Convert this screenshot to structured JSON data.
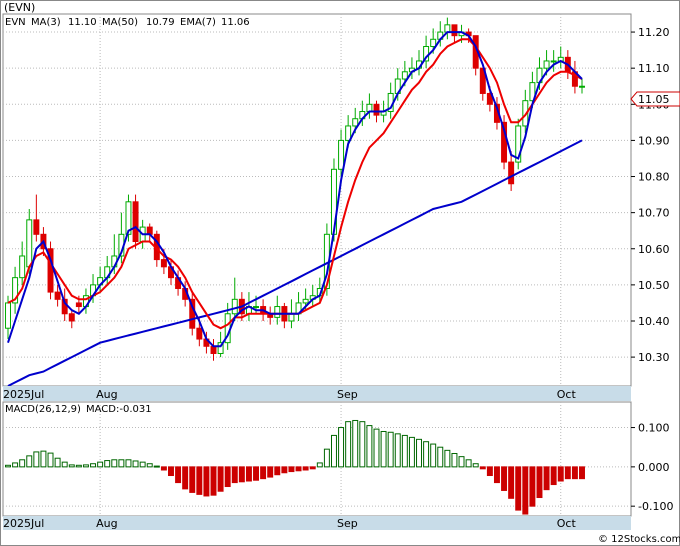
{
  "ticker_label": "(EVN)",
  "legend": {
    "symbol": "EVN",
    "ma3_label": "MA(3)",
    "ma3_value": "11.10",
    "ma50_label": "MA(50)",
    "ma50_value": "10.79",
    "ema7_label": "EMA(7)",
    "ema7_value": "11.06"
  },
  "macd_legend": {
    "label": "MACD(26,12,9)",
    "value_label": "MACD:-0.031"
  },
  "price_tag": "11.05",
  "watermark": "© 12Stocks.com",
  "price_axis": {
    "ticks": [
      "11.20",
      "11.10",
      "11.00",
      "10.90",
      "10.80",
      "10.70",
      "10.60",
      "10.50",
      "10.40",
      "10.30"
    ],
    "tick_values": [
      11.2,
      11.1,
      11.0,
      10.9,
      10.8,
      10.7,
      10.6,
      10.5,
      10.4,
      10.3
    ],
    "range": [
      10.22,
      11.25
    ]
  },
  "macd_axis": {
    "ticks": [
      "0.100",
      "0.000",
      "-0.100"
    ],
    "tick_values": [
      0.1,
      0.0,
      -0.1
    ],
    "range": [
      -0.125,
      0.165
    ]
  },
  "time_axis": {
    "labels": [
      "2025Jul",
      "Aug",
      "Sep",
      "Oct"
    ],
    "label_index": [
      0,
      13,
      47,
      78
    ]
  },
  "colors": {
    "up": "#00aa00",
    "down": "#dd0000",
    "ma": "#0000cc",
    "ema": "#ee0000",
    "macd_up": "#006600",
    "macd_down": "#cc0000",
    "axis_band": "#c8dce8",
    "grid": "#bbbbbb"
  },
  "chart_data": {
    "type": "candlestick",
    "count": 95,
    "candles": {
      "open": [
        10.38,
        10.45,
        10.52,
        10.55,
        10.68,
        10.64,
        10.6,
        10.48,
        10.46,
        10.42,
        10.45,
        10.44,
        10.47,
        10.5,
        10.52,
        10.55,
        10.58,
        10.64,
        10.73,
        10.62,
        10.66,
        10.64,
        10.57,
        10.55,
        10.52,
        10.49,
        10.46,
        10.38,
        10.35,
        10.33,
        10.31,
        10.34,
        10.42,
        10.46,
        10.42,
        10.44,
        10.44,
        10.42,
        10.41,
        10.44,
        10.4,
        10.42,
        10.45,
        10.46,
        10.47,
        10.49,
        10.64,
        10.82,
        10.9,
        10.94,
        10.96,
        10.98,
        11.0,
        10.97,
        10.98,
        11.03,
        11.07,
        11.09,
        11.1,
        11.12,
        11.16,
        11.18,
        11.2,
        11.22,
        11.19,
        11.2,
        11.19,
        11.1,
        11.03,
        11.0,
        10.95,
        10.84,
        10.84,
        10.94,
        11.01,
        11.06,
        11.1,
        11.12,
        11.12,
        11.13,
        11.09,
        11.05
      ],
      "close": [
        10.45,
        10.52,
        10.58,
        10.68,
        10.64,
        10.6,
        10.48,
        10.46,
        10.42,
        10.4,
        10.44,
        10.47,
        10.5,
        10.52,
        10.55,
        10.58,
        10.64,
        10.73,
        10.62,
        10.66,
        10.64,
        10.57,
        10.55,
        10.52,
        10.49,
        10.46,
        10.38,
        10.35,
        10.33,
        10.31,
        10.34,
        10.42,
        10.46,
        10.42,
        10.44,
        10.44,
        10.42,
        10.41,
        10.44,
        10.4,
        10.42,
        10.45,
        10.46,
        10.47,
        10.49,
        10.64,
        10.82,
        10.9,
        10.94,
        10.96,
        10.98,
        11.0,
        10.97,
        10.98,
        11.03,
        11.07,
        11.09,
        11.1,
        11.12,
        11.16,
        11.18,
        11.2,
        11.22,
        11.19,
        11.2,
        11.19,
        11.1,
        11.03,
        11.0,
        10.95,
        10.84,
        10.78,
        10.94,
        11.01,
        11.06,
        11.1,
        11.12,
        11.12,
        11.13,
        11.09,
        11.05,
        11.05
      ],
      "high": [
        10.47,
        10.55,
        10.62,
        10.71,
        10.75,
        10.66,
        10.62,
        10.5,
        10.49,
        10.43,
        10.47,
        10.49,
        10.53,
        10.55,
        10.58,
        10.64,
        10.7,
        10.75,
        10.75,
        10.68,
        10.67,
        10.65,
        10.6,
        10.57,
        10.54,
        10.51,
        10.48,
        10.41,
        10.37,
        10.35,
        10.37,
        10.45,
        10.52,
        10.48,
        10.48,
        10.47,
        10.46,
        10.44,
        10.47,
        10.45,
        10.46,
        10.48,
        10.49,
        10.5,
        10.52,
        10.67,
        10.85,
        10.93,
        10.97,
        10.99,
        11.01,
        11.03,
        11.01,
        11.01,
        11.06,
        11.1,
        11.12,
        11.13,
        11.15,
        11.19,
        11.21,
        11.23,
        11.24,
        11.22,
        11.22,
        11.21,
        11.19,
        11.1,
        11.05,
        11.02,
        10.97,
        10.87,
        10.96,
        11.04,
        11.09,
        11.13,
        11.15,
        11.15,
        11.16,
        11.15,
        11.12,
        11.07
      ],
      "low": [
        10.35,
        10.42,
        10.5,
        10.53,
        10.62,
        10.58,
        10.46,
        10.44,
        10.4,
        10.38,
        10.42,
        10.42,
        10.45,
        10.48,
        10.5,
        10.53,
        10.56,
        10.62,
        10.6,
        10.6,
        10.62,
        10.55,
        10.53,
        10.5,
        10.47,
        10.44,
        10.36,
        10.33,
        10.31,
        10.29,
        10.3,
        10.32,
        10.4,
        10.4,
        10.4,
        10.42,
        10.4,
        10.39,
        10.39,
        10.38,
        10.38,
        10.4,
        10.43,
        10.44,
        10.45,
        10.47,
        10.62,
        10.8,
        10.88,
        10.92,
        10.94,
        10.96,
        10.95,
        10.95,
        10.96,
        11.01,
        11.05,
        11.07,
        11.08,
        11.1,
        11.14,
        11.16,
        11.18,
        11.17,
        11.17,
        11.17,
        11.08,
        11.01,
        10.98,
        10.93,
        10.82,
        10.76,
        10.82,
        10.92,
        10.99,
        11.04,
        11.08,
        11.09,
        11.1,
        11.07,
        11.03,
        11.03
      ]
    },
    "ma3": [
      10.34,
      10.4,
      10.46,
      10.52,
      10.6,
      10.62,
      10.57,
      10.51,
      10.45,
      10.43,
      10.42,
      10.44,
      10.47,
      10.5,
      10.52,
      10.55,
      10.59,
      10.65,
      10.66,
      10.64,
      10.64,
      10.62,
      10.59,
      10.55,
      10.52,
      10.49,
      10.44,
      10.4,
      10.35,
      10.33,
      10.33,
      10.36,
      10.41,
      10.43,
      10.44,
      10.43,
      10.43,
      10.42,
      10.42,
      10.42,
      10.42,
      10.42,
      10.44,
      10.46,
      10.47,
      10.53,
      10.65,
      10.79,
      10.89,
      10.93,
      10.96,
      10.98,
      10.98,
      10.98,
      10.99,
      11.03,
      11.06,
      11.09,
      11.1,
      11.13,
      11.15,
      11.18,
      11.2,
      11.2,
      11.2,
      11.19,
      11.16,
      11.11,
      11.04,
      10.99,
      10.93,
      10.86,
      10.85,
      10.91,
      11.0,
      11.06,
      11.09,
      11.11,
      11.12,
      11.11,
      11.09,
      11.07
    ],
    "ema7": [
      10.45,
      10.46,
      10.49,
      10.55,
      10.58,
      10.59,
      10.56,
      10.53,
      10.5,
      10.47,
      10.46,
      10.46,
      10.47,
      10.48,
      10.5,
      10.52,
      10.55,
      10.6,
      10.61,
      10.62,
      10.62,
      10.6,
      10.58,
      10.57,
      10.55,
      10.52,
      10.48,
      10.45,
      10.42,
      10.39,
      10.38,
      10.39,
      10.41,
      10.41,
      10.42,
      10.42,
      10.42,
      10.42,
      10.42,
      10.42,
      10.42,
      10.42,
      10.43,
      10.44,
      10.45,
      10.5,
      10.58,
      10.66,
      10.73,
      10.79,
      10.84,
      10.88,
      10.9,
      10.92,
      10.95,
      10.98,
      11.01,
      11.04,
      11.06,
      11.09,
      11.11,
      11.14,
      11.16,
      11.17,
      11.18,
      11.18,
      11.16,
      11.13,
      11.1,
      11.06,
      11.0,
      10.95,
      10.95,
      10.97,
      11.0,
      11.03,
      11.06,
      11.08,
      11.09,
      11.09,
      11.08,
      11.07
    ],
    "ma50": [
      10.22,
      10.23,
      10.24,
      10.25,
      10.255,
      10.26,
      10.27,
      10.28,
      10.29,
      10.3,
      10.31,
      10.32,
      10.33,
      10.34,
      10.345,
      10.35,
      10.355,
      10.36,
      10.365,
      10.37,
      10.375,
      10.38,
      10.385,
      10.39,
      10.395,
      10.4,
      10.405,
      10.41,
      10.415,
      10.42,
      10.425,
      10.43,
      10.435,
      10.44,
      10.45,
      10.46,
      10.47,
      10.48,
      10.49,
      10.5,
      10.51,
      10.52,
      10.53,
      10.54,
      10.55,
      10.56,
      10.57,
      10.58,
      10.59,
      10.6,
      10.61,
      10.62,
      10.63,
      10.64,
      10.65,
      10.66,
      10.67,
      10.68,
      10.69,
      10.7,
      10.71,
      10.715,
      10.72,
      10.725,
      10.73,
      10.74,
      10.75,
      10.76,
      10.77,
      10.78,
      10.79,
      10.8,
      10.81,
      10.82,
      10.83,
      10.84,
      10.85,
      10.86,
      10.87,
      10.88,
      10.89,
      10.9
    ],
    "macd_hist": [
      0.004,
      0.01,
      0.018,
      0.028,
      0.038,
      0.04,
      0.035,
      0.022,
      0.012,
      0.005,
      0.004,
      0.005,
      0.008,
      0.012,
      0.016,
      0.018,
      0.018,
      0.018,
      0.015,
      0.012,
      0.008,
      0.002,
      -0.008,
      -0.022,
      -0.04,
      -0.056,
      -0.065,
      -0.07,
      -0.074,
      -0.072,
      -0.062,
      -0.05,
      -0.04,
      -0.038,
      -0.036,
      -0.034,
      -0.03,
      -0.026,
      -0.02,
      -0.015,
      -0.012,
      -0.01,
      -0.008,
      -0.005,
      0.01,
      0.045,
      0.08,
      0.1,
      0.115,
      0.118,
      0.115,
      0.105,
      0.096,
      0.09,
      0.088,
      0.084,
      0.08,
      0.075,
      0.07,
      0.064,
      0.058,
      0.05,
      0.042,
      0.034,
      0.026,
      0.018,
      0.008,
      -0.005,
      -0.022,
      -0.04,
      -0.06,
      -0.08,
      -0.11,
      -0.12,
      -0.1,
      -0.078,
      -0.058,
      -0.045,
      -0.036,
      -0.03,
      -0.03,
      -0.03
    ]
  }
}
